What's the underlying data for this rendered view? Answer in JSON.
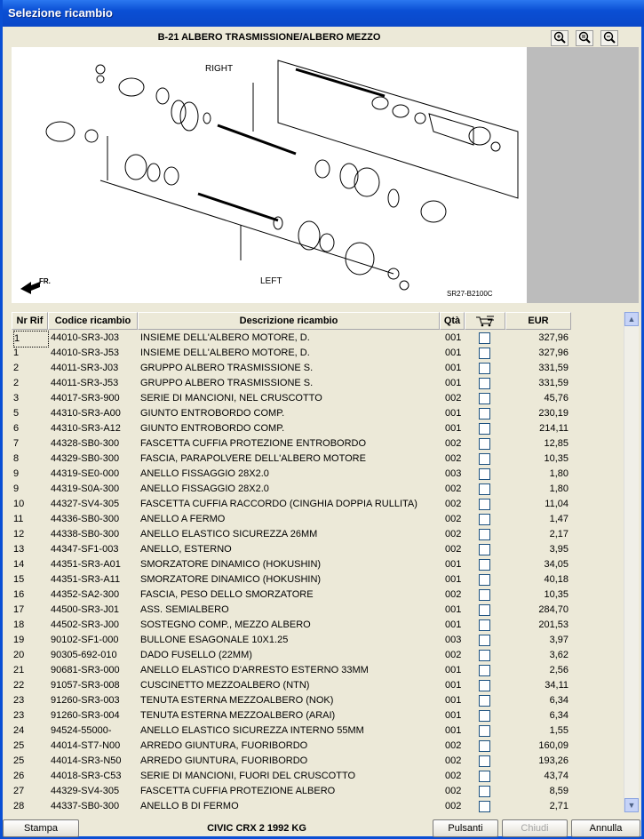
{
  "window": {
    "title": "Selezione ricambio"
  },
  "drawing": {
    "title": "B-21 ALBERO TRASMISSIONE/ALBERO MEZZO",
    "label_right": "RIGHT",
    "label_left": "LEFT",
    "label_fr": "FR.",
    "code": "SR27-B2100C",
    "zoom_buttons": [
      "zoom-in",
      "zoom-fit",
      "zoom-out"
    ]
  },
  "grid": {
    "headers": {
      "nr": "Nr Rif",
      "code": "Codice ricambio",
      "desc": "Descrizione ricambio",
      "qty": "Qtà",
      "cart": "cart-icon",
      "eur": "EUR"
    },
    "rows": [
      {
        "nr": "1",
        "code": "44010-SR3-J03",
        "desc": "INSIEME DELL'ALBERO MOTORE, D.",
        "qty": "001",
        "eur": "327,96"
      },
      {
        "nr": "1",
        "code": "44010-SR3-J53",
        "desc": "INSIEME DELL'ALBERO MOTORE, D.",
        "qty": "001",
        "eur": "327,96"
      },
      {
        "nr": "2",
        "code": "44011-SR3-J03",
        "desc": "GRUPPO ALBERO TRASMISSIONE S.",
        "qty": "001",
        "eur": "331,59"
      },
      {
        "nr": "2",
        "code": "44011-SR3-J53",
        "desc": "GRUPPO ALBERO TRASMISSIONE S.",
        "qty": "001",
        "eur": "331,59"
      },
      {
        "nr": "3",
        "code": "44017-SR3-900",
        "desc": "SERIE DI MANCIONI, NEL CRUSCOTTO",
        "qty": "002",
        "eur": "45,76"
      },
      {
        "nr": "5",
        "code": "44310-SR3-A00",
        "desc": "GIUNTO ENTROBORDO COMP.",
        "qty": "001",
        "eur": "230,19"
      },
      {
        "nr": "6",
        "code": "44310-SR3-A12",
        "desc": "GIUNTO ENTROBORDO COMP.",
        "qty": "001",
        "eur": "214,11"
      },
      {
        "nr": "7",
        "code": "44328-SB0-300",
        "desc": "FASCETTA CUFFIA PROTEZIONE ENTROBORDO",
        "qty": "002",
        "eur": "12,85"
      },
      {
        "nr": "8",
        "code": "44329-SB0-300",
        "desc": "FASCIA, PARAPOLVERE DELL'ALBERO MOTORE",
        "qty": "002",
        "eur": "10,35"
      },
      {
        "nr": "9",
        "code": "44319-SE0-000",
        "desc": "ANELLO FISSAGGIO 28X2.0",
        "qty": "003",
        "eur": "1,80"
      },
      {
        "nr": "9",
        "code": "44319-S0A-300",
        "desc": "ANELLO FISSAGGIO 28X2.0",
        "qty": "002",
        "eur": "1,80"
      },
      {
        "nr": "10",
        "code": "44327-SV4-305",
        "desc": "FASCETTA CUFFIA RACCORDO (CINGHIA DOPPIA RULLITA)",
        "qty": "002",
        "eur": "11,04"
      },
      {
        "nr": "11",
        "code": "44336-SB0-300",
        "desc": "ANELLO A FERMO",
        "qty": "002",
        "eur": "1,47"
      },
      {
        "nr": "12",
        "code": "44338-SB0-300",
        "desc": "ANELLO ELASTICO SICUREZZA 26MM",
        "qty": "002",
        "eur": "2,17"
      },
      {
        "nr": "13",
        "code": "44347-SF1-003",
        "desc": "ANELLO, ESTERNO",
        "qty": "002",
        "eur": "3,95"
      },
      {
        "nr": "14",
        "code": "44351-SR3-A01",
        "desc": "SMORZATORE DINAMICO (HOKUSHIN)",
        "qty": "001",
        "eur": "34,05"
      },
      {
        "nr": "15",
        "code": "44351-SR3-A11",
        "desc": "SMORZATORE DINAMICO (HOKUSHIN)",
        "qty": "001",
        "eur": "40,18"
      },
      {
        "nr": "16",
        "code": "44352-SA2-300",
        "desc": "FASCIA, PESO DELLO SMORZATORE",
        "qty": "002",
        "eur": "10,35"
      },
      {
        "nr": "17",
        "code": "44500-SR3-J01",
        "desc": "ASS. SEMIALBERO",
        "qty": "001",
        "eur": "284,70"
      },
      {
        "nr": "18",
        "code": "44502-SR3-J00",
        "desc": "SOSTEGNO COMP., MEZZO ALBERO",
        "qty": "001",
        "eur": "201,53"
      },
      {
        "nr": "19",
        "code": "90102-SF1-000",
        "desc": "BULLONE ESAGONALE 10X1.25",
        "qty": "003",
        "eur": "3,97"
      },
      {
        "nr": "20",
        "code": "90305-692-010",
        "desc": "DADO FUSELLO (22MM)",
        "qty": "002",
        "eur": "3,62"
      },
      {
        "nr": "21",
        "code": "90681-SR3-000",
        "desc": "ANELLO ELASTICO D'ARRESTO ESTERNO 33MM",
        "qty": "001",
        "eur": "2,56"
      },
      {
        "nr": "22",
        "code": "91057-SR3-008",
        "desc": "CUSCINETTO MEZZOALBERO (NTN)",
        "qty": "001",
        "eur": "34,11"
      },
      {
        "nr": "23",
        "code": "91260-SR3-003",
        "desc": "TENUTA ESTERNA MEZZOALBERO (NOK)",
        "qty": "001",
        "eur": "6,34"
      },
      {
        "nr": "23",
        "code": "91260-SR3-004",
        "desc": "TENUTA ESTERNA MEZZOALBERO (ARAI)",
        "qty": "001",
        "eur": "6,34"
      },
      {
        "nr": "24",
        "code": "94524-55000-",
        "desc": "ANELLO ELASTICO SICUREZZA INTERNO 55MM",
        "qty": "001",
        "eur": "1,55"
      },
      {
        "nr": "25",
        "code": "44014-ST7-N00",
        "desc": "ARREDO GIUNTURA, FUORIBORDO",
        "qty": "002",
        "eur": "160,09"
      },
      {
        "nr": "25",
        "code": "44014-SR3-N50",
        "desc": "ARREDO GIUNTURA, FUORIBORDO",
        "qty": "002",
        "eur": "193,26"
      },
      {
        "nr": "26",
        "code": "44018-SR3-C53",
        "desc": "SERIE DI MANCIONI, FUORI DEL CRUSCOTTO",
        "qty": "002",
        "eur": "43,74"
      },
      {
        "nr": "27",
        "code": "44329-SV4-305",
        "desc": "FASCETTA CUFFIA PROTEZIONE ALBERO",
        "qty": "002",
        "eur": "8,59"
      },
      {
        "nr": "28",
        "code": "44337-SB0-300",
        "desc": "ANELLO B DI FERMO",
        "qty": "002",
        "eur": "2,71"
      }
    ]
  },
  "footer": {
    "print": "Stampa",
    "vehicle": "CIVIC CRX  2  1992  KG",
    "buttons": "Pulsanti",
    "close": "Chiudi",
    "cancel": "Annulla"
  }
}
